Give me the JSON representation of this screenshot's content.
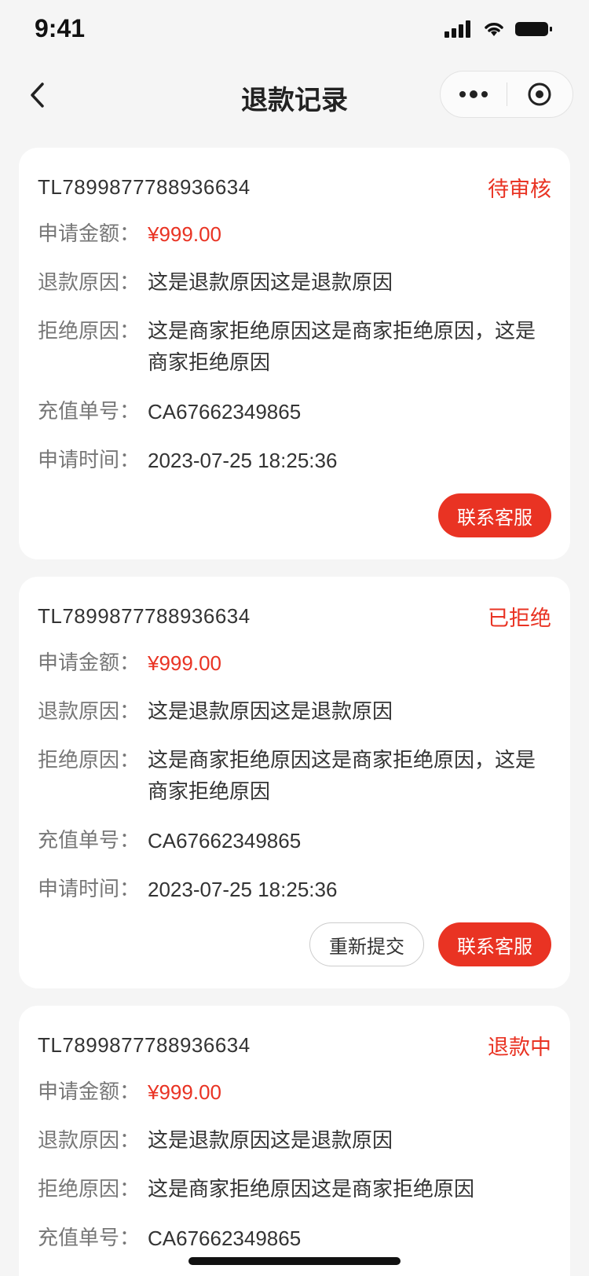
{
  "status_bar": {
    "time": "9:41"
  },
  "nav": {
    "title": "退款记录"
  },
  "labels": {
    "amount": "申请金额：",
    "reason": "退款原因：",
    "reject": "拒绝原因：",
    "recharge_no": "充值单号：",
    "apply_time": "申请时间："
  },
  "colors": {
    "accent": "#e93323",
    "background": "#f5f5f5"
  },
  "records": [
    {
      "order_no": "TL7899877788936634",
      "status": "待审核",
      "amount": "¥999.00",
      "reason": "这是退款原因这是退款原因",
      "reject": "这是商家拒绝原因这是商家拒绝原因，这是商家拒绝原因",
      "recharge_no": "CA67662349865",
      "apply_time": "2023-07-25 18:25:36",
      "contact_label": "联系客服"
    },
    {
      "order_no": "TL7899877788936634",
      "status": "已拒绝",
      "amount": "¥999.00",
      "reason": "这是退款原因这是退款原因",
      "reject": "这是商家拒绝原因这是商家拒绝原因，这是商家拒绝原因",
      "recharge_no": "CA67662349865",
      "apply_time": "2023-07-25 18:25:36",
      "resubmit_label": "重新提交",
      "contact_label": "联系客服"
    },
    {
      "order_no": "TL7899877788936634",
      "status": "退款中",
      "amount": "¥999.00",
      "reason": "这是退款原因这是退款原因",
      "reject": "这是商家拒绝原因这是商家拒绝原因",
      "recharge_no": "CA67662349865"
    }
  ]
}
